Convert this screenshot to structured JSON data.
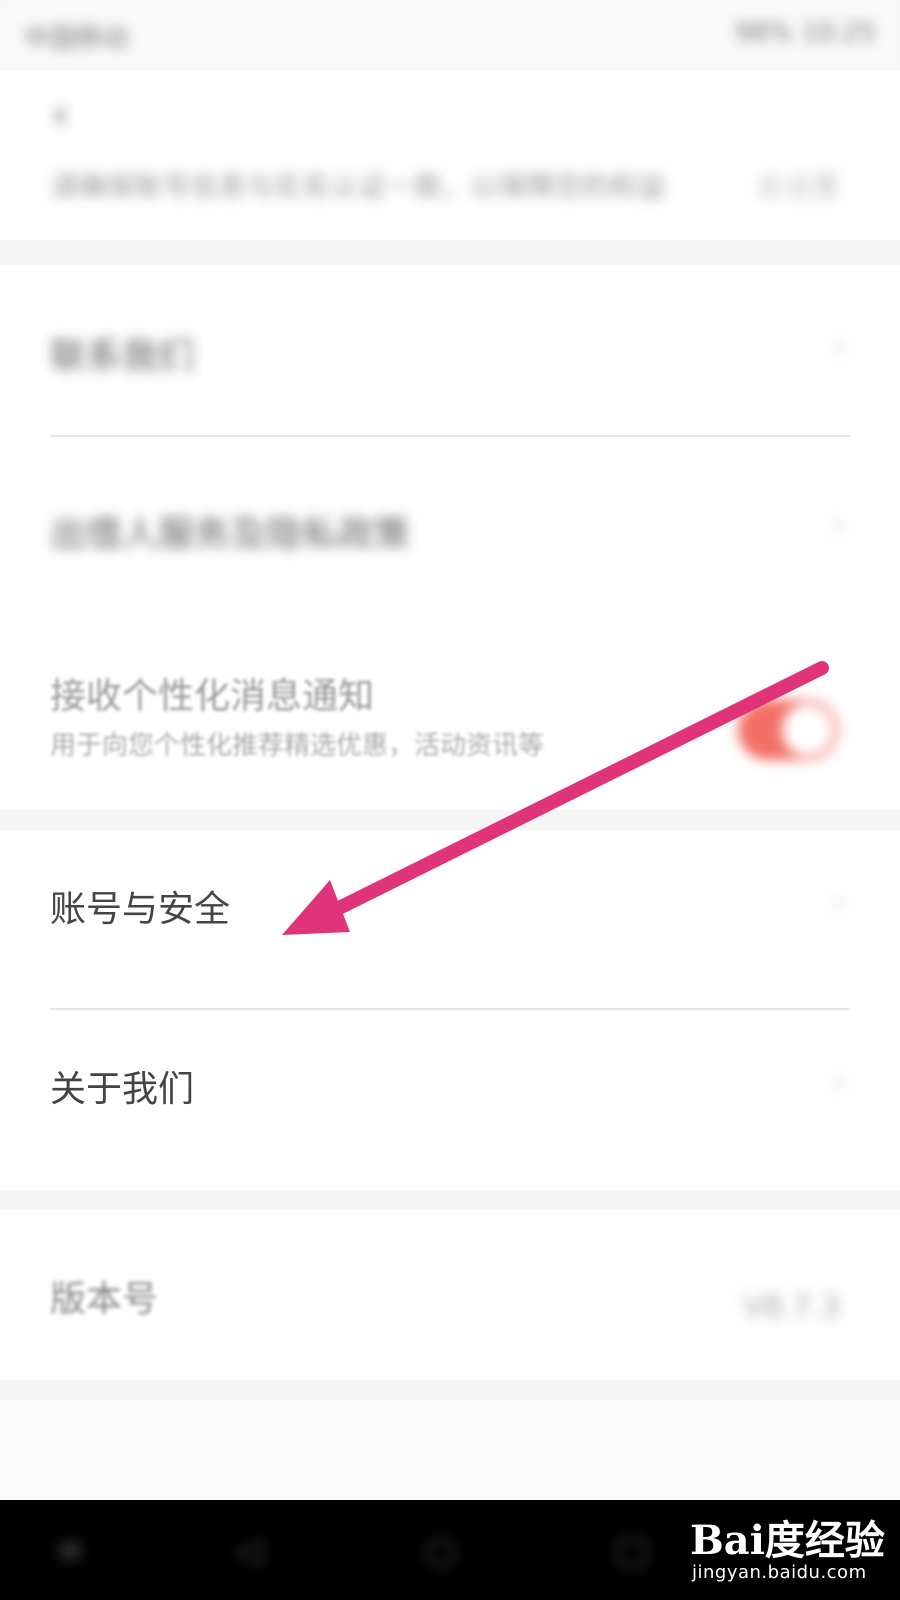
{
  "status_bar": {
    "left": "中国移动",
    "right": "98% 10:25"
  },
  "header": {
    "back_icon": "back-arrow-icon",
    "banner_text": "请确保账号信息与实名认证一致，以保障您的权益",
    "banner_action": "去设置"
  },
  "group1": {
    "row1": {
      "label": "联系我们",
      "chevron": "›"
    },
    "row2": {
      "label": "出借人服务及隐私政策",
      "chevron": "›"
    },
    "row3": {
      "title": "接收个性化消息通知",
      "subtitle": "用于向您个性化推荐精选优惠，活动资讯等",
      "toggle_on": true
    }
  },
  "group2": {
    "row1": {
      "label": "账号与安全",
      "chevron": "›"
    },
    "row2": {
      "label": "关于我们",
      "chevron": "›"
    }
  },
  "group3": {
    "row1": {
      "label": "版本号",
      "value": "V8.7.3"
    }
  },
  "nav_bar": {
    "icons": [
      "menu-icon",
      "back-icon",
      "home-icon",
      "recents-icon"
    ]
  },
  "watermark": {
    "brand": "Bai度经验",
    "url": "jingyan.baidu.com"
  },
  "annotation": {
    "arrow_color": "#e0347a"
  },
  "colors": {
    "toggle_on": "#f0574b",
    "background": "#f5f5f5"
  }
}
